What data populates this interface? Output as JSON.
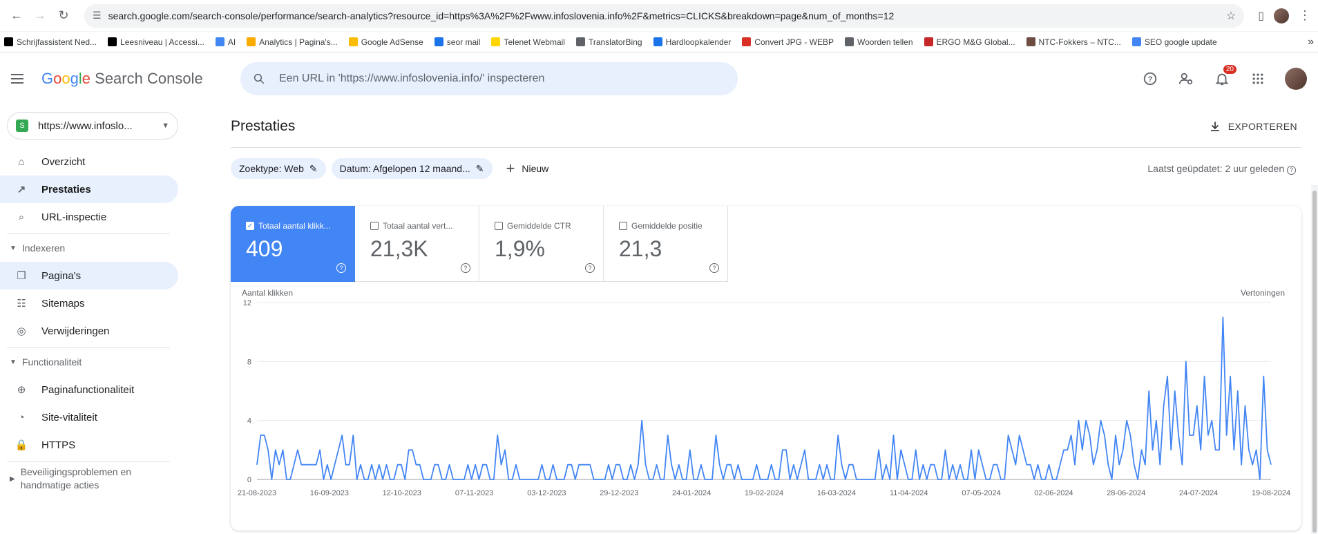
{
  "browser": {
    "url": "search.google.com/search-console/performance/search-analytics?resource_id=https%3A%2F%2Fwww.infoslovenia.info%2F&metrics=CLICKS&breakdown=page&num_of_months=12",
    "bookmarks": [
      {
        "label": "Schrijfassistent Ned...",
        "icon": "vrt-icon",
        "color": "#000000"
      },
      {
        "label": "Leesniveau | Accessi...",
        "icon": "accessibility-icon",
        "color": "#000000"
      },
      {
        "label": "AI",
        "icon": "sparkle-icon",
        "color": "#4285f4"
      },
      {
        "label": "Analytics | Pagina's...",
        "icon": "analytics-icon",
        "color": "#f9ab00"
      },
      {
        "label": "Google AdSense",
        "icon": "adsense-icon",
        "color": "#fbbc05"
      },
      {
        "label": "seor mail",
        "icon": "mail-icon",
        "color": "#1a73e8"
      },
      {
        "label": "Telenet Webmail",
        "icon": "telenet-icon",
        "color": "#ffd600"
      },
      {
        "label": "TranslatorBing",
        "icon": "translate-icon",
        "color": "#5f6368"
      },
      {
        "label": "Hardloopkalender",
        "icon": "box-icon",
        "color": "#1a73e8"
      },
      {
        "label": "Convert JPG - WEBP",
        "icon": "convert-icon",
        "color": "#d93025"
      },
      {
        "label": "Woorden tellen",
        "icon": "globe-icon",
        "color": "#5f6368"
      },
      {
        "label": "ERGO M&G Global...",
        "icon": "ergo-icon",
        "color": "#c62828"
      },
      {
        "label": "NTC-Fokkers – NTC...",
        "icon": "dog-icon",
        "color": "#6d4c41"
      },
      {
        "label": "SEO google update",
        "icon": "google-icon",
        "color": "#4285f4"
      }
    ]
  },
  "header": {
    "logo_google": [
      "G",
      "o",
      "o",
      "g",
      "l",
      "e"
    ],
    "logo_product": "Search Console",
    "search_placeholder": "Een URL in 'https://www.infoslovenia.info/' inspecteren",
    "notification_count": "20"
  },
  "sidebar": {
    "property": "https://www.infoslo...",
    "items_top": [
      {
        "label": "Overzicht",
        "icon": "home-icon"
      },
      {
        "label": "Prestaties",
        "icon": "trending-up-icon"
      },
      {
        "label": "URL-inspectie",
        "icon": "search-icon"
      }
    ],
    "section_indexeren": "Indexeren",
    "items_index": [
      {
        "label": "Pagina's",
        "icon": "pages-icon"
      },
      {
        "label": "Sitemaps",
        "icon": "sitemap-icon"
      },
      {
        "label": "Verwijderingen",
        "icon": "eye-off-icon"
      }
    ],
    "section_functionaliteit": "Functionaliteit",
    "items_func": [
      {
        "label": "Paginafunctionaliteit",
        "icon": "plus-circle-icon"
      },
      {
        "label": "Site-vitaliteit",
        "icon": "speed-icon"
      },
      {
        "label": "HTTPS",
        "icon": "lock-icon"
      }
    ],
    "section_beveiliging": "Beveiligingsproblemen en handmatige acties"
  },
  "main": {
    "title": "Prestaties",
    "export_label": "EXPORTEREN",
    "filters": [
      {
        "label": "Zoektype: Web"
      },
      {
        "label": "Datum: Afgelopen 12 maand..."
      }
    ],
    "new_label": "Nieuw",
    "updated": "Laatst geüpdatet: 2 uur geleden"
  },
  "metrics": [
    {
      "label": "Totaal aantal klikk...",
      "value": "409",
      "checked": true
    },
    {
      "label": "Totaal aantal vert...",
      "value": "21,3K",
      "checked": false
    },
    {
      "label": "Gemiddelde CTR",
      "value": "1,9%",
      "checked": false
    },
    {
      "label": "Gemiddelde positie",
      "value": "21,3",
      "checked": false
    }
  ],
  "chart_data": {
    "type": "line",
    "ylabel": "Aantal klikken",
    "ylabel_right": "Vertoningen",
    "ylim": [
      0,
      12
    ],
    "y_ticks": [
      0,
      4,
      8,
      12
    ],
    "x_tick_labels": [
      "21-08-2023",
      "16-09-2023",
      "12-10-2023",
      "07-11-2023",
      "03-12-2023",
      "29-12-2023",
      "24-01-2024",
      "19-02-2024",
      "16-03-2024",
      "11-04-2024",
      "07-05-2024",
      "02-06-2024",
      "28-06-2024",
      "24-07-2024",
      "19-08-2024"
    ],
    "grid": true,
    "color": "#4285f4",
    "series": [
      {
        "values": [
          1,
          3,
          3,
          2,
          0,
          2,
          1,
          2,
          0,
          0,
          1,
          2,
          1,
          1,
          1,
          1,
          1,
          2,
          0,
          1,
          0,
          1,
          2,
          3,
          1,
          1,
          3,
          0,
          1,
          0,
          0,
          1,
          0,
          1,
          0,
          1,
          0,
          0,
          1,
          1,
          0,
          2,
          2,
          1,
          1,
          0,
          0,
          0,
          1,
          1,
          0,
          0,
          1,
          0,
          0,
          0,
          0,
          1,
          0,
          1,
          0,
          1,
          1,
          0,
          0,
          3,
          1,
          2,
          0,
          0,
          1,
          0,
          0,
          0,
          0,
          0,
          0,
          1,
          0,
          0,
          1,
          0,
          0,
          0,
          1,
          1,
          0,
          1,
          1,
          1,
          1,
          0,
          0,
          0,
          0,
          1,
          0,
          1,
          1,
          0,
          0,
          1,
          0,
          1,
          4,
          1,
          0,
          0,
          1,
          0,
          0,
          3,
          1,
          0,
          1,
          0,
          0,
          2,
          0,
          0,
          1,
          0,
          0,
          0,
          3,
          1,
          0,
          1,
          1,
          0,
          1,
          0,
          0,
          0,
          0,
          1,
          0,
          0,
          0,
          1,
          0,
          0,
          2,
          2,
          0,
          1,
          0,
          1,
          2,
          0,
          0,
          0,
          1,
          0,
          1,
          0,
          0,
          3,
          1,
          0,
          1,
          1,
          0,
          0,
          0,
          0,
          0,
          0,
          2,
          0,
          1,
          0,
          3,
          0,
          2,
          1,
          0,
          0,
          2,
          0,
          1,
          0,
          1,
          1,
          0,
          0,
          2,
          0,
          1,
          0,
          1,
          0,
          0,
          2,
          0,
          2,
          1,
          0,
          0,
          1,
          1,
          0,
          0,
          3,
          2,
          1,
          3,
          2,
          1,
          1,
          0,
          1,
          0,
          0,
          1,
          0,
          0,
          1,
          2,
          2,
          3,
          1,
          4,
          2,
          4,
          3,
          1,
          2,
          4,
          3,
          1,
          0,
          3,
          1,
          2,
          4,
          3,
          1,
          0,
          2,
          1,
          6,
          2,
          4,
          1,
          5,
          7,
          2,
          6,
          3,
          1,
          8,
          3,
          3,
          5,
          2,
          7,
          3,
          4,
          2,
          2,
          11,
          3,
          7,
          2,
          6,
          1,
          5,
          2,
          1,
          2,
          0,
          7,
          2,
          1
        ]
      }
    ]
  }
}
